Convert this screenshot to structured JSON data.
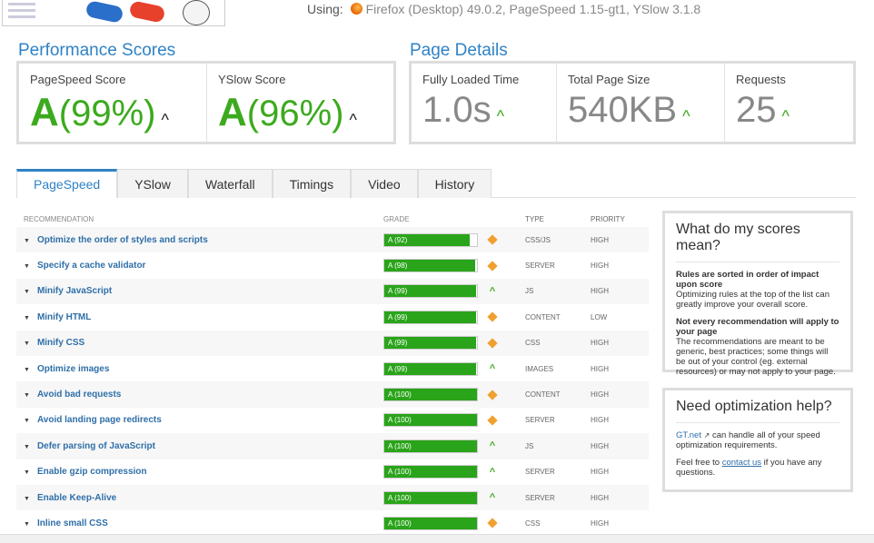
{
  "header": {
    "using_label": "Using:",
    "browser": "Firefox (Desktop) 49.0.2, PageSpeed 1.15-gt1, YSlow 3.1.8"
  },
  "performance": {
    "title": "Performance Scores",
    "pagespeed": {
      "label": "PageSpeed Score",
      "grade": "A",
      "pct": "(99%)"
    },
    "yslow": {
      "label": "YSlow Score",
      "grade": "A",
      "pct": "(96%)"
    }
  },
  "details": {
    "title": "Page Details",
    "loaded": {
      "label": "Fully Loaded Time",
      "value": "1.0s"
    },
    "size": {
      "label": "Total Page Size",
      "value": "540KB"
    },
    "requests": {
      "label": "Requests",
      "value": "25"
    }
  },
  "arrow_up": "^",
  "tabs": [
    "PageSpeed",
    "YSlow",
    "Waterfall",
    "Timings",
    "Video",
    "History"
  ],
  "table": {
    "headers": {
      "rec": "RECOMMENDATION",
      "grade": "GRADE",
      "type": "TYPE",
      "priority": "PRIORITY"
    },
    "rows": [
      {
        "rec": "Optimize the order of styles and scripts",
        "grade": "A (92)",
        "score": 92,
        "icon": "diamond",
        "type": "CSS/JS",
        "priority": "HIGH"
      },
      {
        "rec": "Specify a cache validator",
        "grade": "A (98)",
        "score": 98,
        "icon": "diamond",
        "type": "SERVER",
        "priority": "HIGH"
      },
      {
        "rec": "Minify JavaScript",
        "grade": "A (99)",
        "score": 99,
        "icon": "up",
        "type": "JS",
        "priority": "HIGH"
      },
      {
        "rec": "Minify HTML",
        "grade": "A (99)",
        "score": 99,
        "icon": "diamond",
        "type": "CONTENT",
        "priority": "LOW"
      },
      {
        "rec": "Minify CSS",
        "grade": "A (99)",
        "score": 99,
        "icon": "diamond",
        "type": "CSS",
        "priority": "HIGH"
      },
      {
        "rec": "Optimize images",
        "grade": "A (99)",
        "score": 99,
        "icon": "up",
        "type": "IMAGES",
        "priority": "HIGH"
      },
      {
        "rec": "Avoid bad requests",
        "grade": "A (100)",
        "score": 100,
        "icon": "diamond",
        "type": "CONTENT",
        "priority": "HIGH"
      },
      {
        "rec": "Avoid landing page redirects",
        "grade": "A (100)",
        "score": 100,
        "icon": "diamond",
        "type": "SERVER",
        "priority": "HIGH"
      },
      {
        "rec": "Defer parsing of JavaScript",
        "grade": "A (100)",
        "score": 100,
        "icon": "up",
        "type": "JS",
        "priority": "HIGH"
      },
      {
        "rec": "Enable gzip compression",
        "grade": "A (100)",
        "score": 100,
        "icon": "up",
        "type": "SERVER",
        "priority": "HIGH"
      },
      {
        "rec": "Enable Keep-Alive",
        "grade": "A (100)",
        "score": 100,
        "icon": "up",
        "type": "SERVER",
        "priority": "HIGH"
      },
      {
        "rec": "Inline small CSS",
        "grade": "A (100)",
        "score": 100,
        "icon": "diamond",
        "type": "CSS",
        "priority": "HIGH"
      }
    ]
  },
  "side1": {
    "title": "What do my scores mean?",
    "t1": "Rules are sorted in order of impact upon score",
    "p1": "Optimizing rules at the top of the list can greatly improve your overall score.",
    "t2": "Not every recommendation will apply to your page",
    "p2": "The recommendations are meant to be generic, best practices; some things will be out of your control (eg. external resources) or may not apply to your page."
  },
  "side2": {
    "title": "Need optimization help?",
    "link1": "GT.net",
    "p1": "can handle all of your speed optimization requirements.",
    "p2a": "Feel free to",
    "link2": "contact us",
    "p2b": "if you have any questions."
  },
  "colors": {
    "accent": "#2f82c6",
    "grade_green": "#2aa41a",
    "diamond": "#f0a030"
  }
}
